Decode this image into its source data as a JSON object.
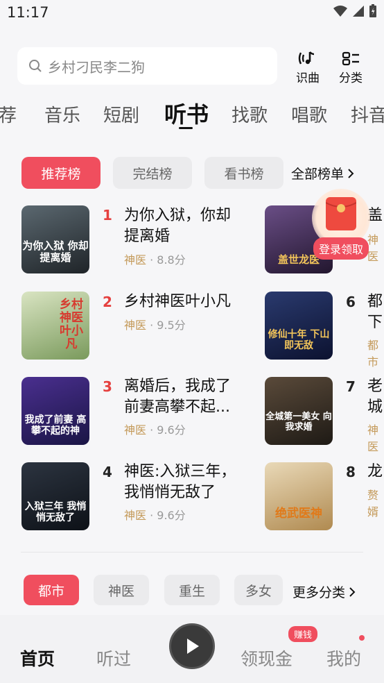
{
  "status": {
    "time": "11:17"
  },
  "search": {
    "placeholder": "乡村刁民李二狗"
  },
  "top_actions": [
    {
      "label": "识曲",
      "icon": "music-recognize-icon"
    },
    {
      "label": "分类",
      "icon": "category-icon"
    }
  ],
  "category_tabs": [
    "荐",
    "音乐",
    "短剧",
    "听书",
    "找歌",
    "唱歌",
    "抖音"
  ],
  "rank_chips": [
    "推荐榜",
    "完结榜",
    "看书榜"
  ],
  "all_rank_label": "全部榜单",
  "books_left": [
    {
      "rank": "1",
      "title_l1": "为你入狱，你却",
      "title_l2": "提离婚",
      "tag": "神医",
      "score": "8.8分",
      "cover_text": "为你入狱 你却提离婚"
    },
    {
      "rank": "2",
      "title_l1": "乡村神医叶小凡",
      "title_l2": "",
      "tag": "神医",
      "score": "9.5分",
      "cover_text": "乡村神医 叶小凡"
    },
    {
      "rank": "3",
      "title_l1": "离婚后，我成了",
      "title_l2": "前妻高攀不起...",
      "tag": "神医",
      "score": "9.6分",
      "cover_text": "我成了前妻 高攀不起的神"
    },
    {
      "rank": "4",
      "title_l1": "神医:入狱三年，",
      "title_l2": "我悄悄无敌了",
      "tag": "神医",
      "score": "9.6分",
      "cover_text": "入狱三年 我悄悄无敌了"
    }
  ],
  "books_right": [
    {
      "rank": "",
      "title_l1": "盖",
      "title_l2": "",
      "tag": "神医",
      "cover_text": "盖世龙医"
    },
    {
      "rank": "6",
      "title_l1": "都",
      "title_l2": "下",
      "tag": "都市",
      "cover_text": "修仙十年 下山即无敌"
    },
    {
      "rank": "7",
      "title_l1": "老",
      "title_l2": "城",
      "tag": "神医",
      "cover_text": "全城第一美女 向我求婚"
    },
    {
      "rank": "8",
      "title_l1": "龙",
      "title_l2": "",
      "tag": "赘婿",
      "cover_text": "绝武医神"
    }
  ],
  "promo": {
    "label": "登录领取"
  },
  "genre_chips": [
    "都市",
    "神医",
    "重生",
    "多女"
  ],
  "more_categories_label": "更多分类",
  "bottom_nav": {
    "home": "首页",
    "listened": "听过",
    "cash": "领现金",
    "mine": "我的",
    "earn_badge": "赚钱"
  },
  "colors": {
    "accent": "#f04e5e",
    "tag": "#c49a5a"
  }
}
